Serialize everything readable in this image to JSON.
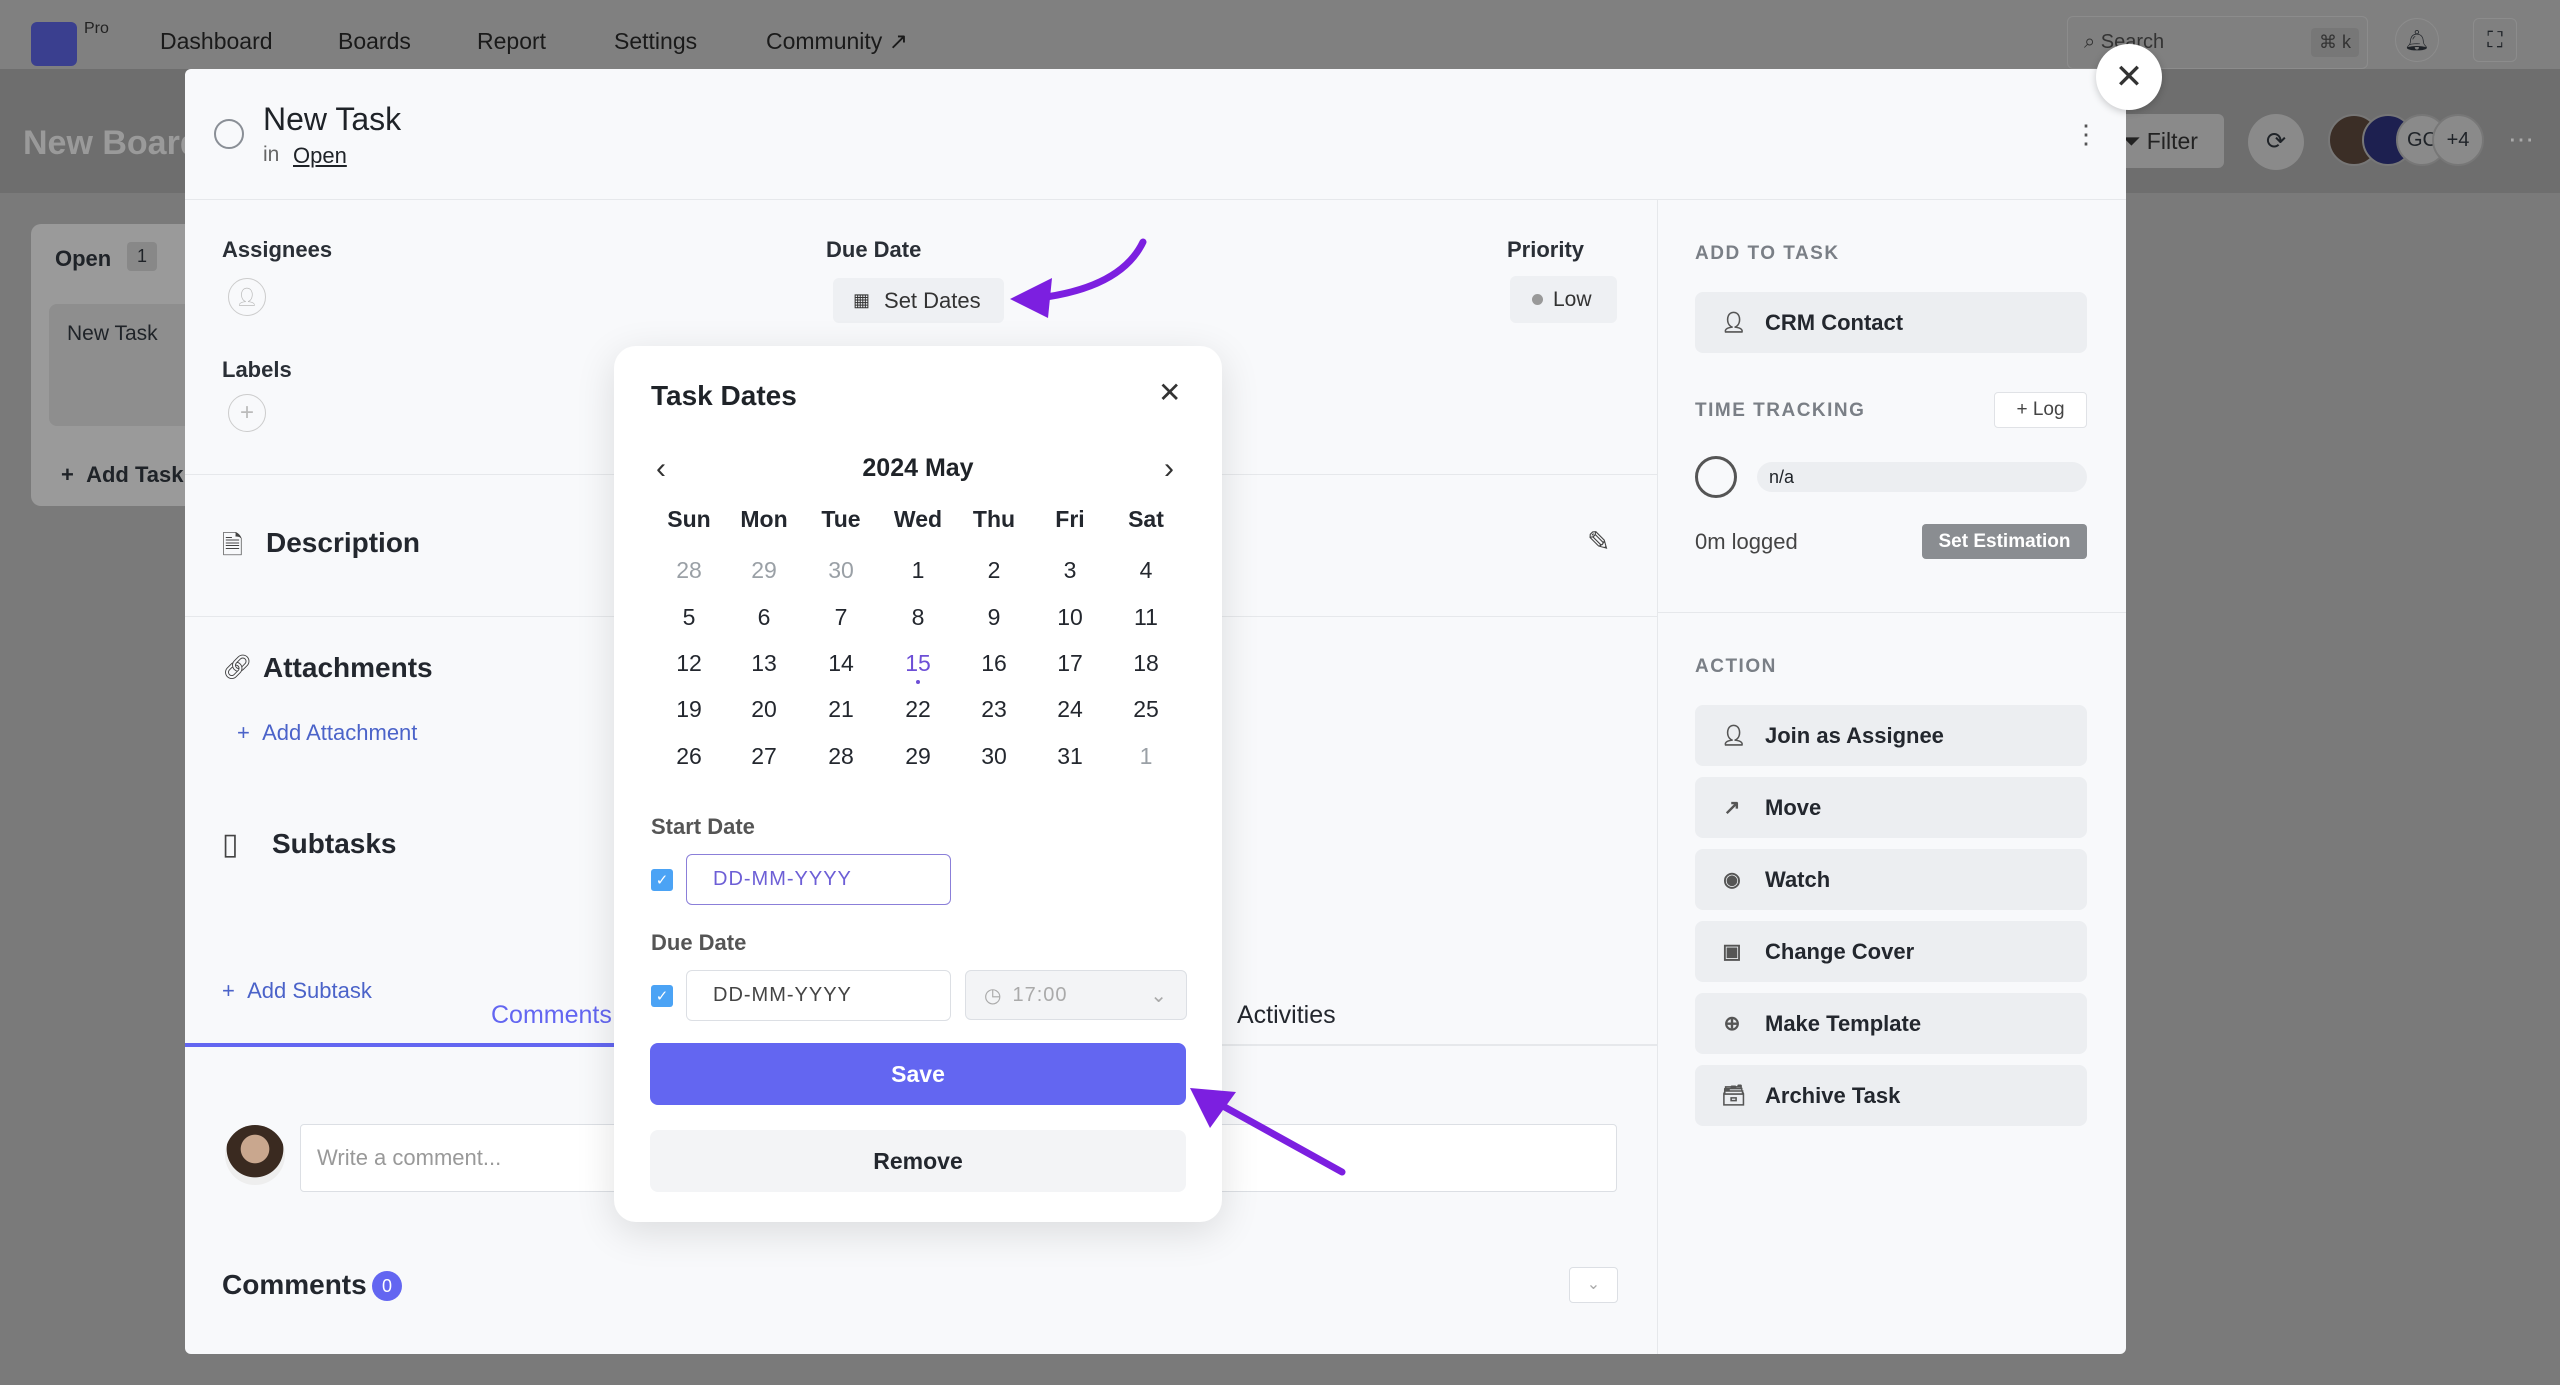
{
  "topnav": {
    "logo_badge": "Pro",
    "links": [
      "Dashboard",
      "Boards",
      "Report",
      "Settings",
      "Community ↗"
    ],
    "search_placeholder": "Search",
    "shortcut": "⌘ k"
  },
  "board": {
    "title": "New Board",
    "column": {
      "name": "Open",
      "count": "1",
      "card": "New Task",
      "add": "Add Task"
    },
    "filter": "Filter",
    "avatar_initials": "GC",
    "avatar_more": "+4"
  },
  "task": {
    "title": "New Task",
    "in_label": "in",
    "stage": "Open",
    "assignees_label": "Assignees",
    "labels_label": "Labels",
    "due_label": "Due Date",
    "set_dates": "Set Dates",
    "priority_label": "Priority",
    "priority": "Low",
    "description": "Description",
    "attachments": "Attachments",
    "add_attachment": "Add Attachment",
    "subtasks": "Subtasks",
    "add_subtask": "Add Subtask",
    "tabs": [
      "Comments",
      "Activities"
    ],
    "comment_placeholder": "Write a comment...",
    "comments_heading": "Comments",
    "comments_count": "0"
  },
  "sidebar": {
    "add_to_task": "ADD TO TASK",
    "crm": "CRM Contact",
    "time_tracking": "TIME TRACKING",
    "log": "+ Log",
    "estimate": "n/a",
    "logged": "0m logged",
    "set_estimation": "Set Estimation",
    "action": "ACTION",
    "actions": [
      {
        "label": "Join as Assignee",
        "icon": "user-icon"
      },
      {
        "label": "Move",
        "icon": "arrow-up-right-icon"
      },
      {
        "label": "Watch",
        "icon": "eye-icon"
      },
      {
        "label": "Change Cover",
        "icon": "image-icon"
      },
      {
        "label": "Make Template",
        "icon": "plus-circle-icon"
      },
      {
        "label": "Archive Task",
        "icon": "archive-icon"
      }
    ]
  },
  "datepicker": {
    "title": "Task Dates",
    "month": "2024 May",
    "weekdays": [
      "Sun",
      "Mon",
      "Tue",
      "Wed",
      "Thu",
      "Fri",
      "Sat"
    ],
    "weeks": [
      [
        "28",
        "29",
        "30",
        "1",
        "2",
        "3",
        "4"
      ],
      [
        "5",
        "6",
        "7",
        "8",
        "9",
        "10",
        "11"
      ],
      [
        "12",
        "13",
        "14",
        "15",
        "16",
        "17",
        "18"
      ],
      [
        "19",
        "20",
        "21",
        "22",
        "23",
        "24",
        "25"
      ],
      [
        "26",
        "27",
        "28",
        "29",
        "30",
        "31",
        "1"
      ]
    ],
    "today": "15",
    "start_label": "Start Date",
    "start_placeholder": "DD-MM-YYYY",
    "due_label": "Due Date",
    "due_placeholder": "DD-MM-YYYY",
    "time": "17:00",
    "save": "Save",
    "remove": "Remove"
  },
  "colors": {
    "accent": "#6366f1",
    "arrow": "#7c1fe0",
    "checkbox": "#4ba3f5"
  }
}
